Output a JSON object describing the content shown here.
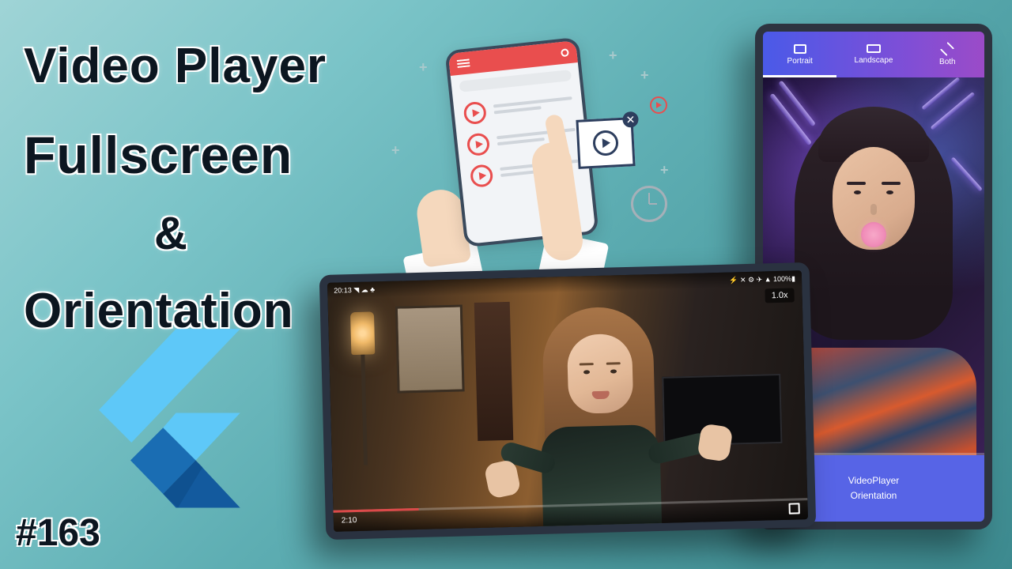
{
  "title": {
    "line1": "Video Player",
    "line2": "Fullscreen",
    "line3": "&",
    "line4": "Orientation"
  },
  "hash_number": "#163",
  "portrait_phone": {
    "tabs": [
      {
        "label": "Portrait",
        "active": true
      },
      {
        "label": "Landscape",
        "active": false
      },
      {
        "label": "Both",
        "active": false
      }
    ],
    "footer_line1": "VideoPlayer",
    "footer_line2": "Orientation"
  },
  "landscape_phone": {
    "status_left": "20:13 ◥ ☁ ♣",
    "status_right": "⚡ ✕ ⚙ ✈ ▲ 100%▮",
    "speed_label": "1.0x",
    "time_label": "2:10"
  }
}
